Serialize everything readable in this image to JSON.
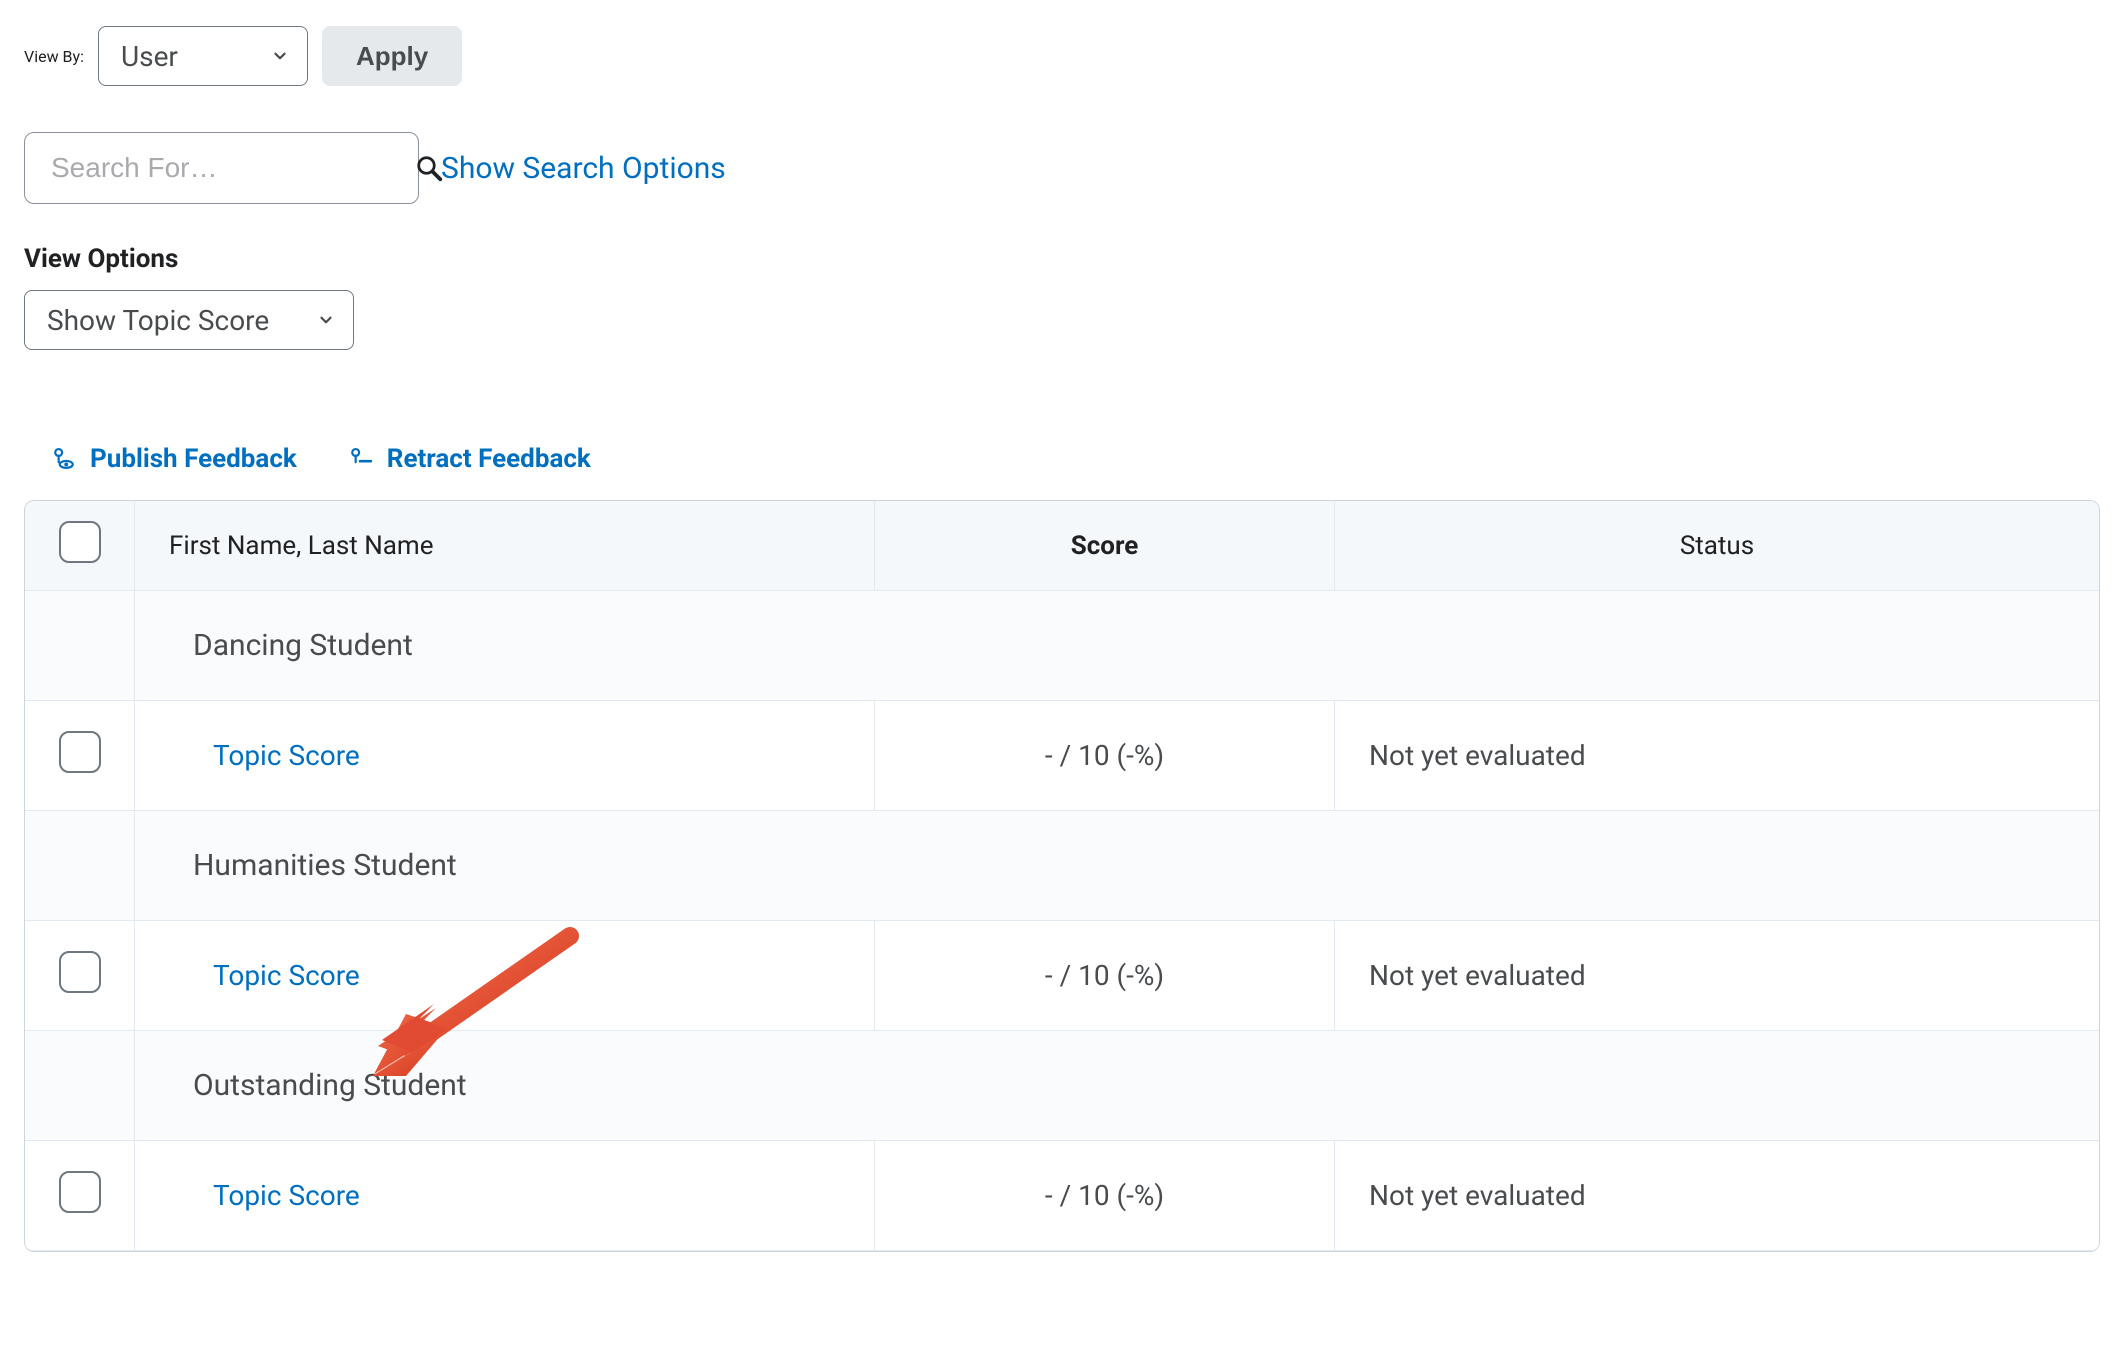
{
  "viewBy": {
    "label": "View By:",
    "selected": "User",
    "options": [
      "User"
    ]
  },
  "applyButtonLabel": "Apply",
  "search": {
    "placeholder": "Search For…",
    "value": "",
    "showOptionsLabel": "Show Search Options"
  },
  "viewOptions": {
    "heading": "View Options",
    "selected": "Show Topic Score",
    "options": [
      "Show Topic Score"
    ]
  },
  "actions": {
    "publish": "Publish Feedback",
    "retract": "Retract Feedback"
  },
  "table": {
    "headers": {
      "name": "First Name, Last Name",
      "score": "Score",
      "status": "Status"
    },
    "topicScoreLabel": "Topic Score",
    "rows": [
      {
        "student": "Dancing Student",
        "score": "- / 10 (-%)",
        "status": "Not yet evaluated"
      },
      {
        "student": "Humanities Student",
        "score": "- / 10 (-%)",
        "status": "Not yet evaluated"
      },
      {
        "student": "Outstanding Student",
        "score": "- / 10 (-%)",
        "status": "Not yet evaluated"
      }
    ]
  },
  "colors": {
    "link": "#006fbf",
    "arrow": "#e24b33"
  }
}
